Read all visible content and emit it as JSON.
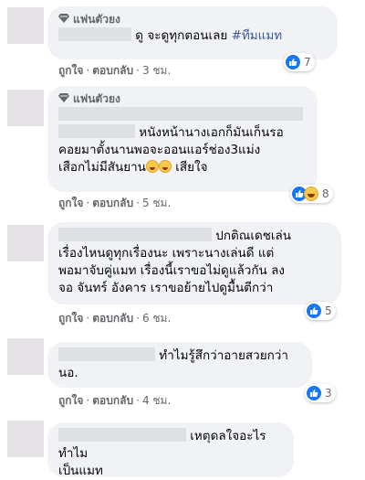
{
  "labels": {
    "like": "ถูกใจ",
    "reply": "ตอบกลับ",
    "dot": "·",
    "fan_badge": "แฟนตัวยง"
  },
  "colors": {
    "bubble": "#f0f2f5",
    "link": "#385898",
    "like": "#1877f2",
    "meta": "#65676b"
  },
  "comments": [
    {
      "badge": true,
      "text_parts": [
        "ดู จะดูทุกตอนเลย ",
        "#ทีมแมท"
      ],
      "time": "3 ชม.",
      "reactions": [
        "like-icon"
      ],
      "count": "7"
    },
    {
      "badge": true,
      "lines": [
        "หนังหน้านางเอกก็มันเก็นรอ",
        "คอยมาตั้งนานพอจะออนแอร์ช่อง3แม่ง",
        "เสือกไม่มีสันยาน",
        "เสียใจ"
      ],
      "time": "5 ชม.",
      "reactions": [
        "like-icon",
        "haha-icon"
      ],
      "count": "8"
    },
    {
      "badge": false,
      "lines": [
        "ปกติณเดชเล่น",
        "เรื่องไหนดูทุกเรื่องนะ เพราะนางเล่นดี แต่",
        "พอมาจับคู่แมท เรื่องนี้เราขอไม่ดูแล้วกัน ลง",
        "จอ จันทร์ อังคาร เราขอย้ายไปดูมื้นตีกว่า"
      ],
      "time": "6 ชม.",
      "reactions": [
        "like-icon"
      ],
      "count": "5"
    },
    {
      "badge": false,
      "lines": [
        "ทำไมรู้สึกว่าอายสวยกว่า",
        "นอ."
      ],
      "time": "4 ชม.",
      "reactions": [
        "like-icon"
      ],
      "count": "3"
    },
    {
      "badge": false,
      "lines": [
        "เหตุดลใจอะไรทำไม",
        "เป็นแมท"
      ]
    }
  ]
}
